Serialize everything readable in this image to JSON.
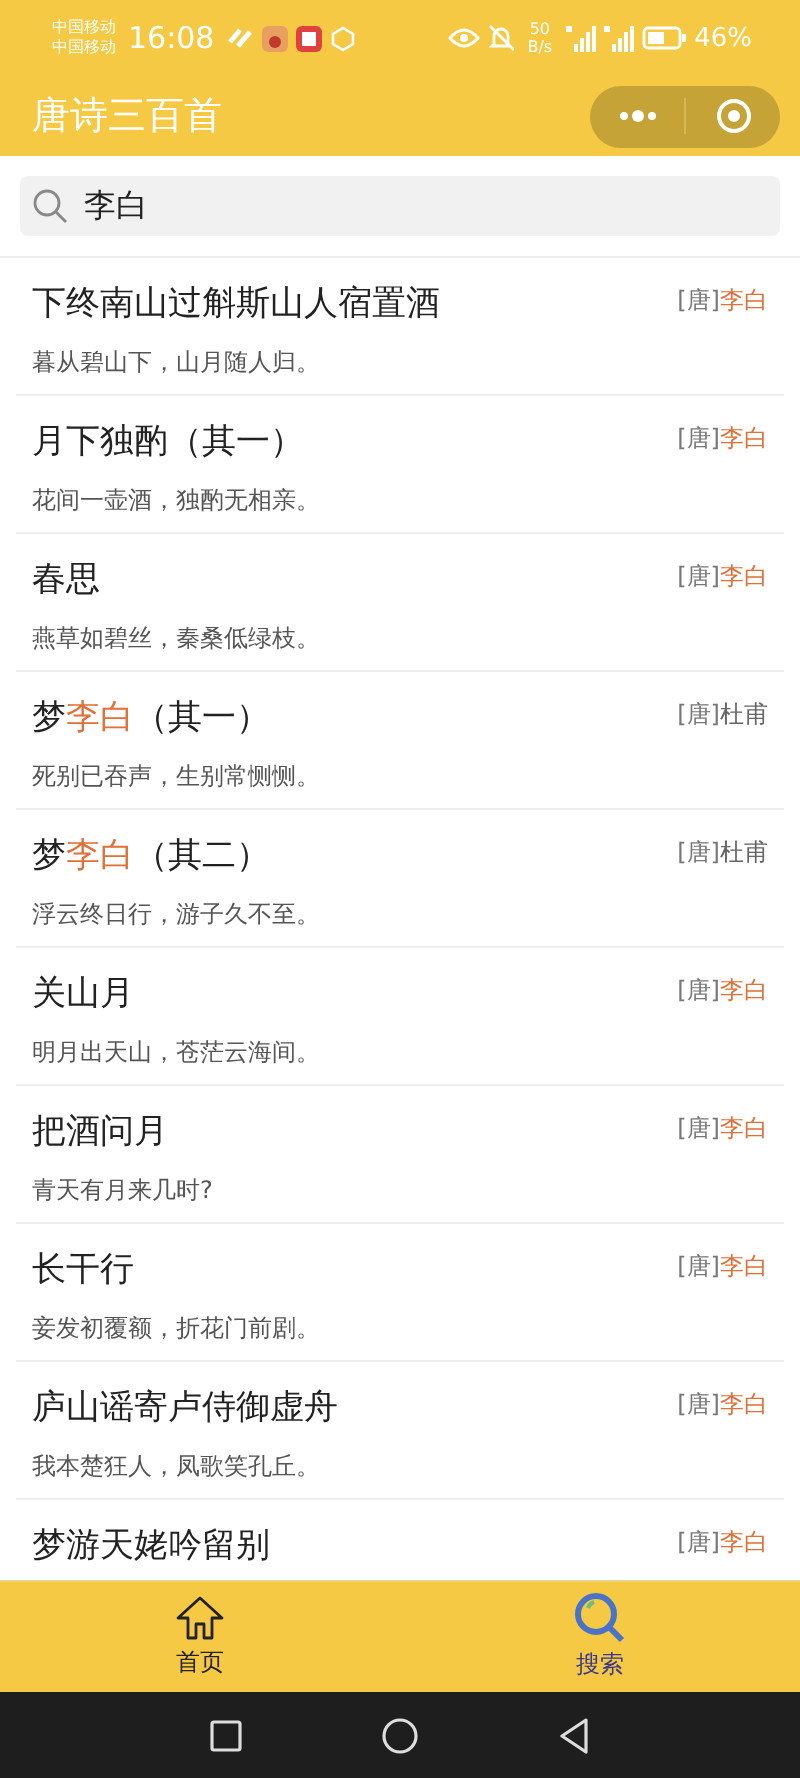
{
  "status_bar": {
    "carriers": [
      "中国移动",
      "中国移动"
    ],
    "time": "16:08",
    "net_speed": [
      "50",
      "B/s"
    ],
    "battery": "46%"
  },
  "header": {
    "title": "唐诗三百首"
  },
  "search": {
    "value": "李白"
  },
  "results": [
    {
      "title": "下终南山过斛斯山人宿置酒",
      "dynasty": "[唐]",
      "author": "李白",
      "author_matched": true,
      "line": "暮从碧山下，山月随人归。"
    },
    {
      "title": "月下独酌（其一）",
      "dynasty": "[唐]",
      "author": "李白",
      "author_matched": true,
      "line": "花间一壶酒，独酌无相亲。"
    },
    {
      "title": "春思",
      "dynasty": "[唐]",
      "author": "李白",
      "author_matched": true,
      "line": "燕草如碧丝，秦桑低绿枝。"
    },
    {
      "title": "梦**李白**（其一）",
      "dynasty": "[唐]",
      "author": "杜甫",
      "author_matched": false,
      "line": "死别已吞声，生别常恻恻。"
    },
    {
      "title": "梦**李白**（其二）",
      "dynasty": "[唐]",
      "author": "杜甫",
      "author_matched": false,
      "line": "浮云终日行，游子久不至。"
    },
    {
      "title": "关山月",
      "dynasty": "[唐]",
      "author": "李白",
      "author_matched": true,
      "line": "明月出天山，苍茫云海间。"
    },
    {
      "title": "把酒问月",
      "dynasty": "[唐]",
      "author": "李白",
      "author_matched": true,
      "line": "青天有月来几时?"
    },
    {
      "title": "长干行",
      "dynasty": "[唐]",
      "author": "李白",
      "author_matched": true,
      "line": "妾发初覆额，折花门前剧。"
    },
    {
      "title": "庐山谣寄卢侍御虚舟",
      "dynasty": "[唐]",
      "author": "李白",
      "author_matched": true,
      "line": "我本楚狂人，凤歌笑孔丘。"
    },
    {
      "title": "梦游天姥吟留别",
      "dynasty": "[唐]",
      "author": "李白",
      "author_matched": true
    }
  ],
  "tabs": [
    {
      "label": "首页",
      "kind": "home",
      "selected": false
    },
    {
      "label": "搜索",
      "kind": "search",
      "selected": true
    }
  ]
}
